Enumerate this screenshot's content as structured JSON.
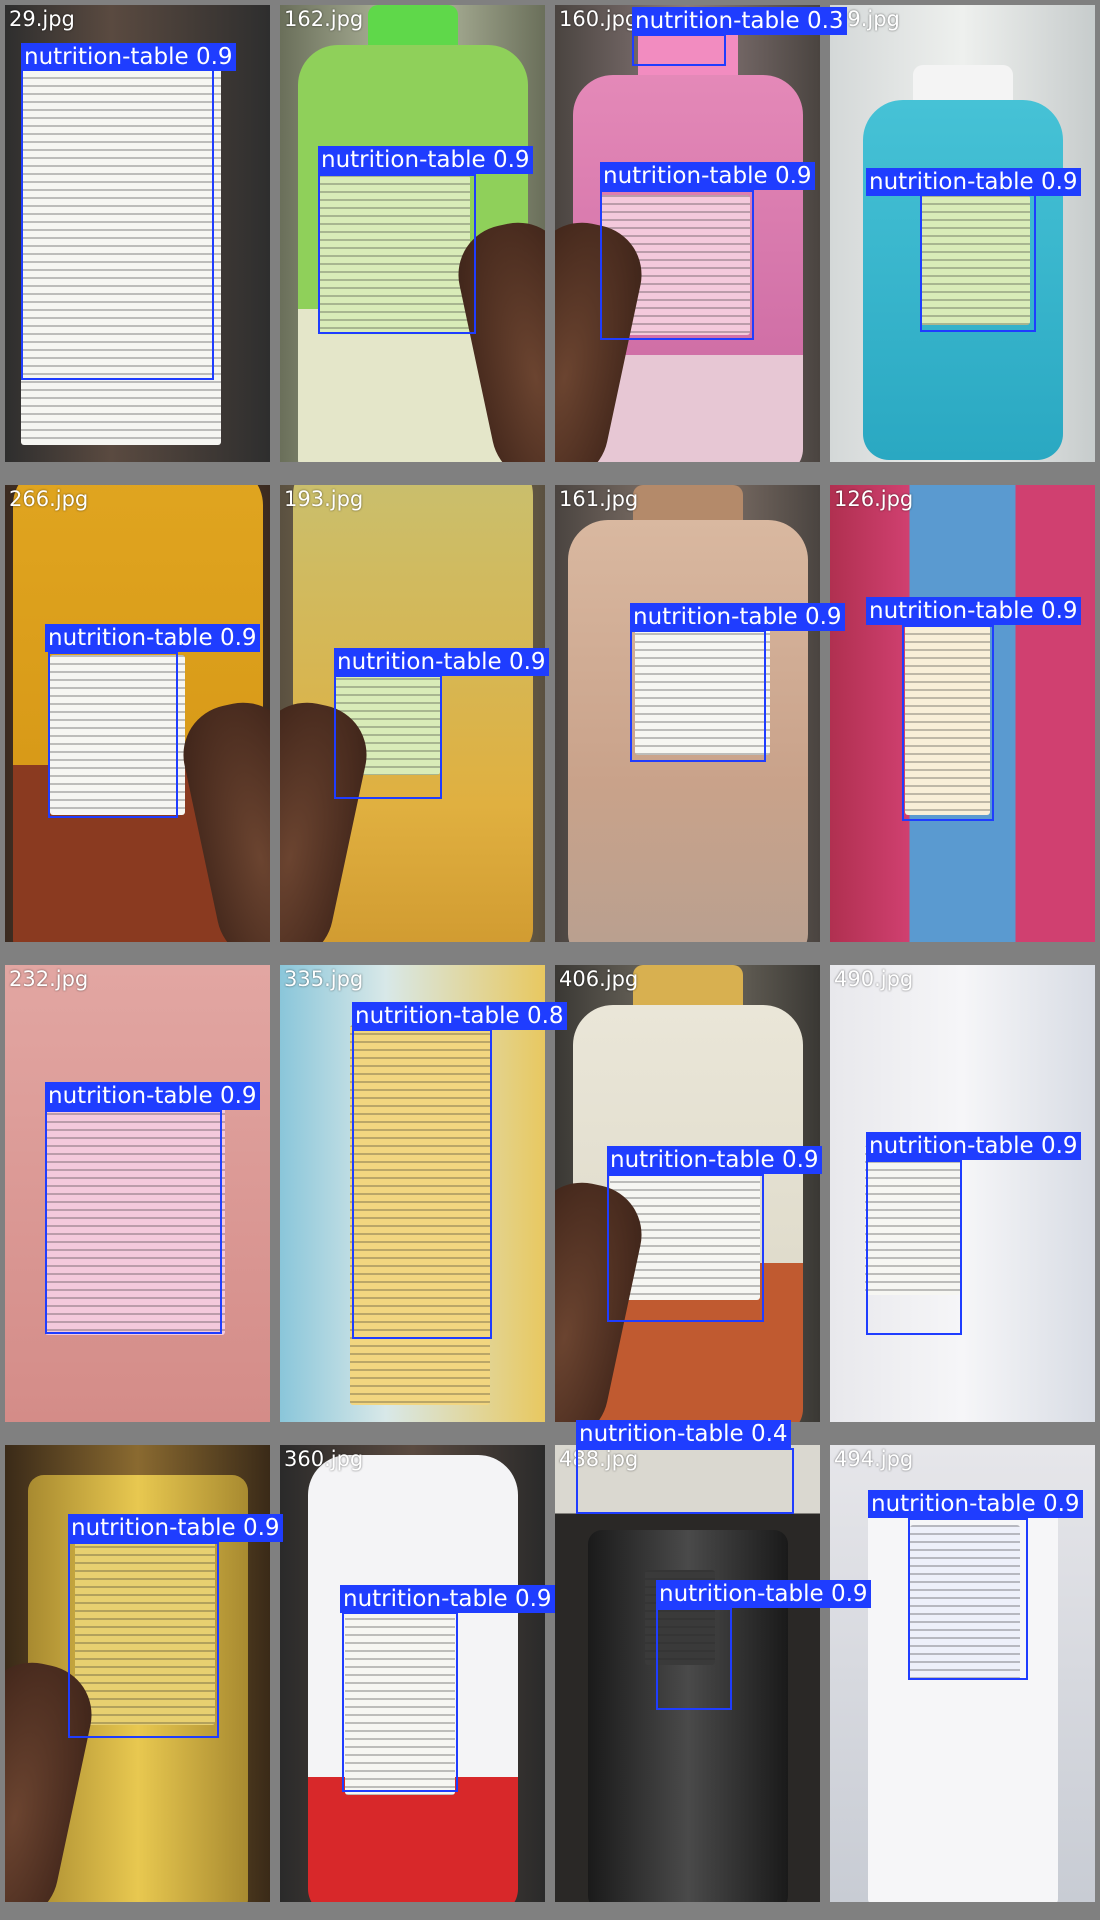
{
  "detection_label": "nutrition-table",
  "box_color": "#1f3dff",
  "cells": [
    {
      "file": "29.jpg",
      "score": "0.9"
    },
    {
      "file": "162.jpg",
      "score": "0.9"
    },
    {
      "file": "160.jpg",
      "score": "0.9",
      "extra_score": "0.3"
    },
    {
      "file": "59.jpg",
      "score": "0.9"
    },
    {
      "file": "266.jpg",
      "score": "0.9"
    },
    {
      "file": "193.jpg",
      "score": "0.9"
    },
    {
      "file": "161.jpg",
      "score": "0.9"
    },
    {
      "file": "126.jpg",
      "score": "0.9"
    },
    {
      "file": "232.jpg",
      "score": "0.9"
    },
    {
      "file": "335.jpg",
      "score": "0.8"
    },
    {
      "file": "406.jpg",
      "score": "0.9"
    },
    {
      "file": "490.jpg",
      "score": "0.9"
    },
    {
      "file": "",
      "score": "0.9"
    },
    {
      "file": "360.jpg",
      "score": "0.9"
    },
    {
      "file": "488.jpg",
      "score": "0.9",
      "extra_score": "0.4"
    },
    {
      "file": "494.jpg",
      "score": "0.9"
    }
  ],
  "label_texts": {
    "c0": "nutrition-table 0.9",
    "c1": "nutrition-table 0.9",
    "c2": "nutrition-table 0.9",
    "c2b": "nutrition-table 0.3",
    "c3": "nutrition-table 0.9",
    "c4": "nutrition-table 0.9",
    "c5": "nutrition-table 0.9",
    "c6": "nutrition-table 0.9",
    "c7": "nutrition-table 0.9",
    "c8": "nutrition-table 0.9",
    "c9": "nutrition-table 0.8",
    "c10": "nutrition-table 0.9",
    "c11": "nutrition-table 0.9",
    "c12": "nutrition-table 0.9",
    "c13": "nutrition-table 0.9",
    "c14": "nutrition-table 0.9",
    "c14b": "nutrition-table 0.4",
    "c15": "nutrition-table 0.9"
  }
}
